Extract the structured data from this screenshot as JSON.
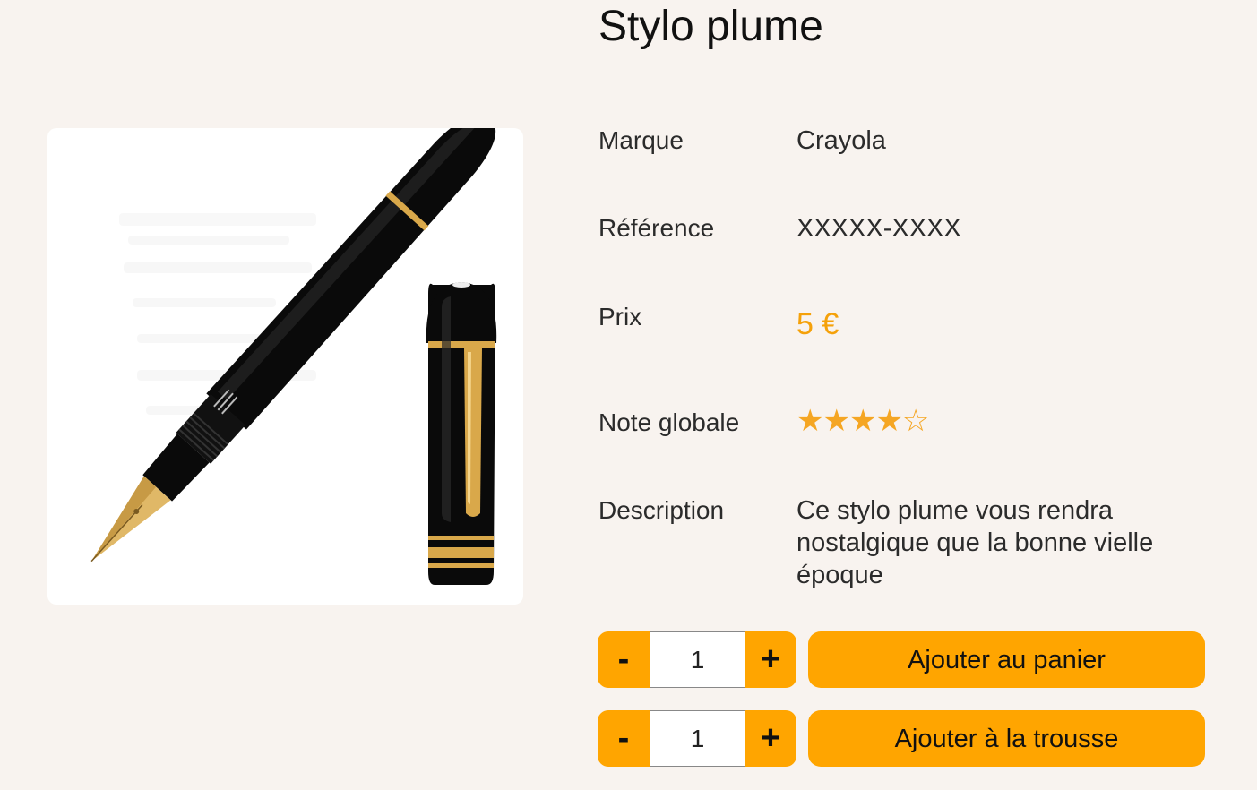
{
  "product": {
    "title": "Stylo plume",
    "image_alt": "fountain pen image",
    "brand_label": "Marque",
    "brand_value": "Crayola",
    "reference_label": "Référence",
    "reference_value": "XXXXX-XXXX",
    "price_label": "Prix",
    "price_value": "5 €",
    "rating_label": "Note globale",
    "rating_value": 4,
    "rating_max": 5,
    "rating_filled": "★★★★",
    "rating_empty": "☆",
    "description_label": "Description",
    "description_value": "Ce stylo plume vous rendra nostalgique que la bonne vielle époque"
  },
  "cart": {
    "quantity": "1",
    "minus_label": "-",
    "plus_label": "+",
    "add_label": "Ajouter au panier"
  },
  "kit": {
    "quantity": "1",
    "minus_label": "-",
    "plus_label": "+",
    "add_label": "Ajouter à la trousse"
  },
  "colors": {
    "background": "#f8f3ef",
    "accent": "#ffa500",
    "price": "#f5a10a"
  }
}
